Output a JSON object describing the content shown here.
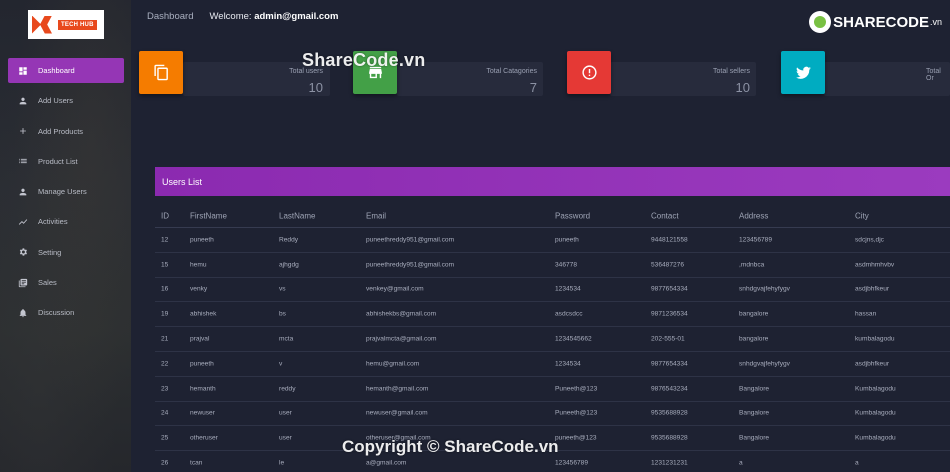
{
  "logo": {
    "badge": "TECH HUB"
  },
  "sidebar": {
    "items": [
      {
        "label": "Dashboard",
        "icon": "dashboard-icon",
        "active": true
      },
      {
        "label": "Add Users",
        "icon": "user-icon"
      },
      {
        "label": "Add Products",
        "icon": "plus-icon"
      },
      {
        "label": "Product List",
        "icon": "list-icon"
      },
      {
        "label": "Manage Users",
        "icon": "user-icon"
      },
      {
        "label": "Activities",
        "icon": "chart-line-icon"
      },
      {
        "label": "Setting",
        "icon": "gear-icon"
      },
      {
        "label": "Sales",
        "icon": "library-icon"
      },
      {
        "label": "Discussion",
        "icon": "bell-icon"
      }
    ]
  },
  "topbar": {
    "crumb": "Dashboard",
    "welcome_prefix": "Welcome: ",
    "welcome_user": "admin@gmail.com"
  },
  "brand": {
    "name": "SHARECODE",
    "tld": ".vn"
  },
  "watermark": {
    "top": "ShareCode.vn",
    "bottom": "Copyright © ShareCode.vn"
  },
  "cards": [
    {
      "label": "Total users",
      "value": "10",
      "color": "#f57c00",
      "icon": "copy-icon"
    },
    {
      "label": "Total Catagories",
      "value": "7",
      "color": "#43a047",
      "icon": "store-icon"
    },
    {
      "label": "Total sellers",
      "value": "10",
      "color": "#e53935",
      "icon": "info-icon"
    },
    {
      "label": "Total Or",
      "value": "",
      "color": "#00acc1",
      "icon": "twitter-icon"
    }
  ],
  "users_panel": {
    "title": "Users List",
    "columns": [
      "ID",
      "FirstName",
      "LastName",
      "Email",
      "Password",
      "Contact",
      "Address",
      "City"
    ],
    "rows": [
      [
        "12",
        "puneeth",
        "Reddy",
        "puneethreddy951@gmail.com",
        "puneeth",
        "9448121558",
        "123456789",
        "sdcjns,djc"
      ],
      [
        "15",
        "hemu",
        "ajhgdg",
        "puneethreddy951@gmail.com",
        "346778",
        "536487276",
        ",mdnbca",
        "asdmhmhvbv"
      ],
      [
        "16",
        "venky",
        "vs",
        "venkey@gmail.com",
        "1234534",
        "9877654334",
        "snhdgvajfehyfygv",
        "asdjbhfkeur"
      ],
      [
        "19",
        "abhishek",
        "bs",
        "abhishekbs@gmail.com",
        "asdcsdcc",
        "9871236534",
        "bangalore",
        "hassan"
      ],
      [
        "21",
        "prajval",
        "mcta",
        "prajvalmcta@gmail.com",
        "1234545662",
        "202-555-01",
        "bangalore",
        "kumbalagodu"
      ],
      [
        "22",
        "puneeth",
        "v",
        "hemu@gmail.com",
        "1234534",
        "9877654334",
        "snhdgvajfehyfygv",
        "asdjbhfkeur"
      ],
      [
        "23",
        "hemanth",
        "reddy",
        "hemanth@gmail.com",
        "Puneeth@123",
        "9876543234",
        "Bangalore",
        "Kumbalagodu"
      ],
      [
        "24",
        "newuser",
        "user",
        "newuser@gmail.com",
        "Puneeth@123",
        "9535688928",
        "Bangalore",
        "Kumbalagodu"
      ],
      [
        "25",
        "otheruser",
        "user",
        "otheruser@gmail.com",
        "puneeth@123",
        "9535688928",
        "Bangalore",
        "Kumbalagodu"
      ],
      [
        "26",
        "tcan",
        "le",
        "a@gmail.com",
        "123456789",
        "1231231231",
        "a",
        "a"
      ]
    ]
  }
}
